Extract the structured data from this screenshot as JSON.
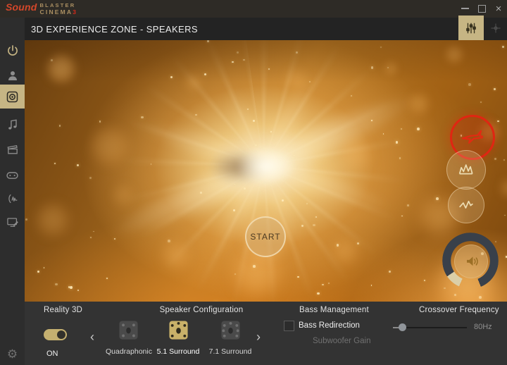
{
  "logo": {
    "sound": "Sound",
    "blaster": "BLASTER",
    "cinema": "CINEMA",
    "three": "3"
  },
  "header": {
    "title": "3D EXPERIENCE ZONE - SPEAKERS"
  },
  "icons": {
    "close": "×",
    "gear": "⚙",
    "chevron_left": "‹",
    "chevron_right": "›"
  },
  "sidebar": {
    "selected": "speakers",
    "items": [
      "power",
      "profile",
      "speakers",
      "music",
      "movies",
      "games",
      "voice",
      "display",
      "settings"
    ]
  },
  "main": {
    "start_label": "START",
    "demo_buttons": [
      "jet-demo",
      "crown-wave-demo",
      "zigzag-wave-demo"
    ],
    "volume_icon": "speaker-with-waves"
  },
  "panel": {
    "reality3d": {
      "title": "Reality 3D",
      "state": "ON",
      "enabled": true
    },
    "speaker_config": {
      "title": "Speaker Configuration",
      "options": [
        {
          "label": "Quadraphonic",
          "selected": false
        },
        {
          "label": "5.1 Surround",
          "selected": true
        },
        {
          "label": "7.1 Surround",
          "selected": false
        }
      ]
    },
    "bass": {
      "title": "Bass Management",
      "redirection_label": "Bass Redirection",
      "redirection_checked": false,
      "subwoofer_label": "Subwoofer Gain"
    },
    "crossover": {
      "title": "Crossover Frequency",
      "value": "80Hz",
      "slider_pos": 0.13
    }
  },
  "colors": {
    "accent_tan": "#c6b584",
    "selected_icon_tan": "#c9b169",
    "accent_red": "#e02612",
    "panel_bg": "#333333"
  }
}
